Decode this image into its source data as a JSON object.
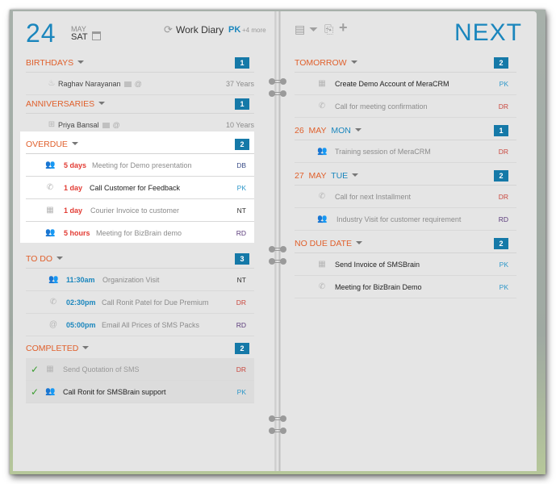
{
  "left_header": {
    "day_number": "24",
    "month": "MAY",
    "weekday": "SAT",
    "diary_title": "Work Diary",
    "user": "PK",
    "more": "+4 more"
  },
  "right_header": {
    "title": "NEXT",
    "tools": [
      {
        "icon": "print-icon",
        "glyph": "🖶"
      },
      {
        "icon": "filter-icon",
        "glyph": "▼"
      },
      {
        "icon": "export-icon",
        "glyph": "⎘"
      },
      {
        "icon": "add-icon",
        "glyph": "+"
      }
    ]
  },
  "birthdays": {
    "title": "BIRTHDAYS",
    "count": "1",
    "items": [
      {
        "name": "Raghav Narayanan",
        "extra": "37 Years"
      }
    ]
  },
  "anniversaries": {
    "title": "ANNIVERSARIES",
    "count": "1",
    "items": [
      {
        "name": "Priya Bansal",
        "extra": "10 Years"
      }
    ]
  },
  "overdue": {
    "title": "OVERDUE",
    "count": "2",
    "items": [
      {
        "type": "meeting",
        "when": "5 days",
        "text": "Meeting for Demo presentation",
        "who": "DB"
      },
      {
        "type": "call",
        "when": "1 day",
        "text": "Call Customer for Feedback",
        "who": "PK"
      },
      {
        "type": "task",
        "when": "1 day",
        "text": "Courier Invoice to customer",
        "who": "NT"
      },
      {
        "type": "meeting",
        "when": "5 hours",
        "text": "Meeting for BizBrain demo",
        "who": "RD"
      }
    ]
  },
  "todo": {
    "title": "TO DO",
    "count": "3",
    "items": [
      {
        "type": "meeting",
        "when": "11:30am",
        "text": "Organization Visit",
        "who": "NT"
      },
      {
        "type": "call",
        "when": "02:30pm",
        "text": "Call Ronit Patel for Due Premium",
        "who": "DR"
      },
      {
        "type": "email",
        "when": "05:00pm",
        "text": "Email All Prices of SMS Packs",
        "who": "RD"
      }
    ]
  },
  "completed": {
    "title": "COMPLETED",
    "count": "2",
    "items": [
      {
        "type": "task",
        "text": "Send Quotation of SMS",
        "who": "DR"
      },
      {
        "type": "meeting",
        "text": "Call Ronit for SMSBrain support",
        "who": "PK"
      }
    ]
  },
  "tomorrow": {
    "title": "TOMORROW",
    "count": "2",
    "items": [
      {
        "type": "task",
        "text": "Create Demo Account of MeraCRM",
        "who": "PK"
      },
      {
        "type": "call",
        "text": "Call for meeting confirmation",
        "who": "DR"
      }
    ]
  },
  "may26": {
    "day": "26",
    "month": "MAY",
    "weekday": "MON",
    "count": "1",
    "items": [
      {
        "type": "meeting",
        "text": "Training session of MeraCRM",
        "who": "DR"
      }
    ]
  },
  "may27": {
    "day": "27",
    "month": "MAY",
    "weekday": "TUE",
    "count": "2",
    "items": [
      {
        "type": "call",
        "text": "Call for next Installment",
        "who": "DR"
      },
      {
        "type": "meeting",
        "text": "Industry Visit for customer requirement",
        "who": "RD"
      }
    ]
  },
  "no_due_date": {
    "title": "NO DUE DATE",
    "count": "2",
    "items": [
      {
        "type": "task",
        "text": "Send Invoice of SMSBrain",
        "who": "PK"
      },
      {
        "type": "call",
        "text": "Meeting for BizBrain Demo",
        "who": "PK"
      }
    ]
  }
}
